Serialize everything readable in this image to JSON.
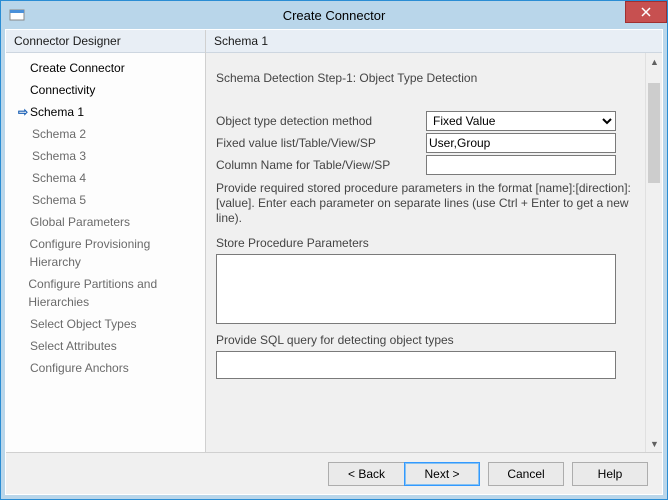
{
  "window": {
    "title": "Create Connector"
  },
  "sidebar": {
    "header": "Connector Designer",
    "items": [
      {
        "label": "Create Connector",
        "state": "done"
      },
      {
        "label": "Connectivity",
        "state": "done"
      },
      {
        "label": "Schema 1",
        "state": "active"
      },
      {
        "label": "Schema 2",
        "state": "sub"
      },
      {
        "label": "Schema 3",
        "state": "sub"
      },
      {
        "label": "Schema 4",
        "state": "sub"
      },
      {
        "label": "Schema 5",
        "state": "sub"
      },
      {
        "label": "Global Parameters",
        "state": "pending"
      },
      {
        "label": "Configure Provisioning Hierarchy",
        "state": "pending"
      },
      {
        "label": "Configure Partitions and Hierarchies",
        "state": "pending"
      },
      {
        "label": "Select Object Types",
        "state": "pending"
      },
      {
        "label": "Select Attributes",
        "state": "pending"
      },
      {
        "label": "Configure Anchors",
        "state": "pending"
      }
    ]
  },
  "panel": {
    "header": "Schema 1",
    "step_title": "Schema Detection Step-1: Object Type Detection",
    "fields": {
      "method_label": "Object type detection method",
      "method_value": "Fixed Value",
      "fixed_list_label": "Fixed value list/Table/View/SP",
      "fixed_list_value": "User,Group",
      "column_label": "Column Name for Table/View/SP",
      "column_value": ""
    },
    "hint": "Provide required stored procedure parameters in the format [name]:[direction]:[value]. Enter each parameter on separate lines (use Ctrl + Enter to get a new line).",
    "sp_params_label": "Store Procedure Parameters",
    "sp_params_value": "",
    "sql_label": "Provide SQL query for detecting object types",
    "sql_value": ""
  },
  "footer": {
    "back": "<  Back",
    "next": "Next  >",
    "cancel": "Cancel",
    "help": "Help"
  }
}
